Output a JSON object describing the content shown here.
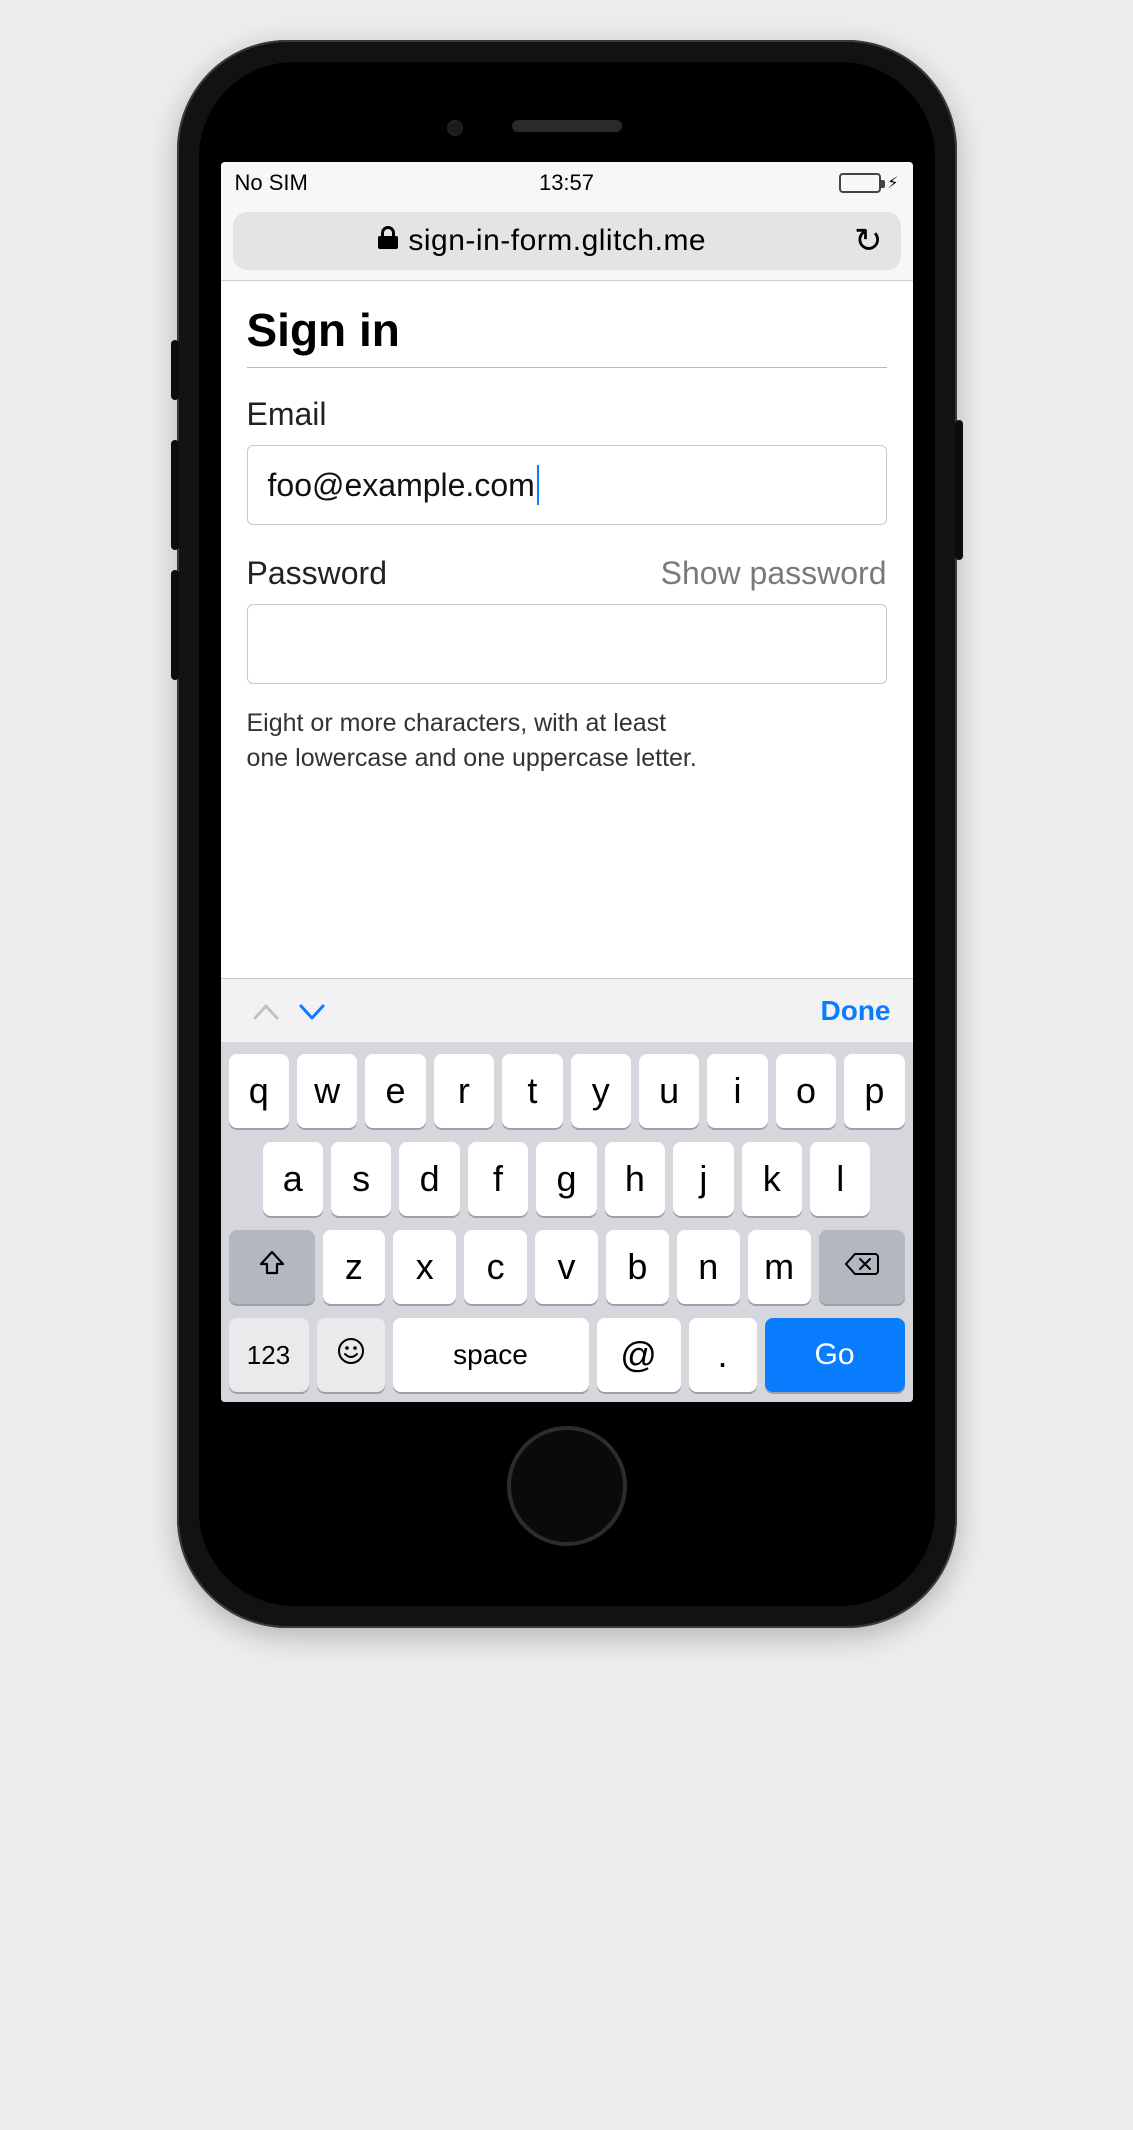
{
  "status": {
    "carrier": "No SIM",
    "time": "13:57"
  },
  "browser": {
    "url": "sign-in-form.glitch.me"
  },
  "form": {
    "heading": "Sign in",
    "email_label": "Email",
    "email_value": "foo@example.com",
    "password_label": "Password",
    "show_password_label": "Show password",
    "password_value": "",
    "password_hint_line1": "Eight or more characters, with at least",
    "password_hint_line2": "one lowercase and one uppercase letter."
  },
  "kb_accessory": {
    "done": "Done"
  },
  "keyboard": {
    "row1": [
      "q",
      "w",
      "e",
      "r",
      "t",
      "y",
      "u",
      "i",
      "o",
      "p"
    ],
    "row2": [
      "a",
      "s",
      "d",
      "f",
      "g",
      "h",
      "j",
      "k",
      "l"
    ],
    "row3": [
      "z",
      "x",
      "c",
      "v",
      "b",
      "n",
      "m"
    ],
    "k123": "123",
    "space": "space",
    "at": "@",
    "dot": ".",
    "go": "Go"
  }
}
